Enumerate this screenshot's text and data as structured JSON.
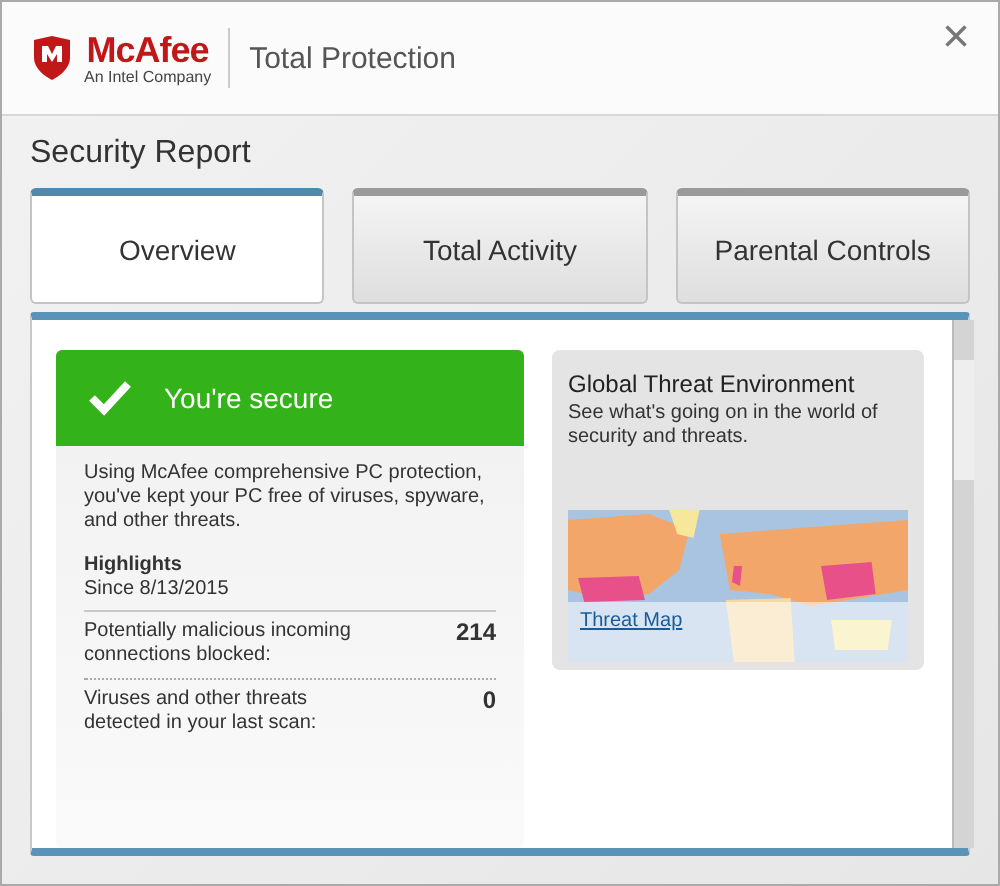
{
  "header": {
    "brand": "McAfee",
    "brand_tagline": "An Intel Company",
    "product": "Total Protection",
    "close": "×"
  },
  "title": "Security Report",
  "tabs": [
    {
      "label": "Overview",
      "selected": true
    },
    {
      "label": "Total Activity",
      "selected": false
    },
    {
      "label": "Parental Controls",
      "selected": false
    }
  ],
  "status_card": {
    "status": "You're secure",
    "secure": true,
    "description": "Using McAfee comprehensive PC protection, you've kept your PC free of viruses, spyware, and other threats.",
    "highlights_title": "Highlights",
    "highlights_since": "Since 8/13/2015",
    "stats": [
      {
        "label": "Potentially malicious incoming connections blocked:",
        "value": "214"
      },
      {
        "label": "Viruses and other threats detected in your last scan:",
        "value": "0"
      }
    ]
  },
  "threat_card": {
    "title": "Global Threat Environment",
    "description": "See what's going on in the world of security and threats.",
    "link": "Threat Map"
  }
}
